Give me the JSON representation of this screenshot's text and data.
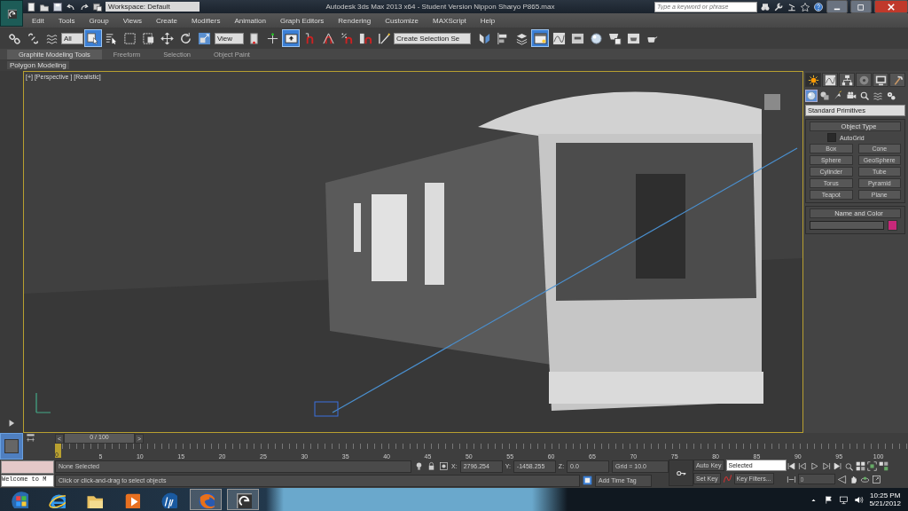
{
  "title_bar": {
    "quick_access": [
      {
        "kind": "new"
      },
      {
        "kind": "open"
      },
      {
        "kind": "save"
      },
      {
        "kind": "undo"
      },
      {
        "kind": "redo"
      },
      {
        "kind": "project"
      }
    ],
    "workspace": "Workspace: Default",
    "title": "Autodesk 3ds Max  2013 x64  - Student Version   Nippon Sharyo P865.max",
    "search": {
      "placeholder": "Type a keyword or phrase"
    },
    "tools": [
      {
        "kind": "binoculars"
      },
      {
        "kind": "wrench"
      },
      {
        "kind": "satellite"
      },
      {
        "kind": "star"
      },
      {
        "kind": "help"
      }
    ]
  },
  "menu": [
    "Edit",
    "Tools",
    "Group",
    "Views",
    "Create",
    "Modifiers",
    "Animation",
    "Graph Editors",
    "Rendering",
    "Customize",
    "MAXScript",
    "Help"
  ],
  "toolbar": [
    {
      "kind": "chain",
      "selected": false
    },
    {
      "kind": "broken-chain",
      "selected": false
    },
    {
      "kind": "wave",
      "selected": false
    },
    {
      "kind": "dropdown",
      "value": "All"
    },
    {
      "kind": "cursor-square",
      "selected": true
    },
    {
      "kind": "cursor-list",
      "selected": false
    },
    {
      "kind": "dashed-square",
      "selected": false
    },
    {
      "kind": "dashed-split",
      "selected": false
    },
    {
      "kind": "move",
      "selected": false
    },
    {
      "kind": "rotate",
      "selected": false
    },
    {
      "kind": "scale",
      "selected": false
    },
    {
      "kind": "dropdown",
      "value": "View"
    },
    {
      "kind": "pivot",
      "selected": false
    },
    {
      "kind": "crosshair",
      "selected": false
    },
    {
      "kind": "arrow-up",
      "selected": true
    },
    {
      "kind": "snap",
      "selected": false
    },
    {
      "kind": "angle-snap",
      "selected": false
    },
    {
      "kind": "percent-snap",
      "selected": false
    },
    {
      "kind": "spinner-snap",
      "selected": false
    },
    {
      "kind": "pencil",
      "selected": false
    },
    {
      "kind": "dropdown",
      "value": "Create Selection Se"
    },
    {
      "kind": "mirror",
      "selected": false
    },
    {
      "kind": "align",
      "selected": false
    },
    {
      "kind": "layers",
      "selected": false
    },
    {
      "kind": "window",
      "selected": true
    },
    {
      "kind": "curve",
      "selected": false
    },
    {
      "kind": "schematic",
      "selected": false
    },
    {
      "kind": "sphere",
      "selected": false
    },
    {
      "kind": "teapot-dialog",
      "selected": false
    },
    {
      "kind": "teapot-frame",
      "selected": false
    },
    {
      "kind": "teapot",
      "selected": false
    }
  ],
  "ribbon": {
    "tabs": [
      {
        "label": "Graphite Modeling Tools",
        "selected": true
      },
      {
        "label": "Freeform",
        "selected": false
      },
      {
        "label": "Selection",
        "selected": false
      },
      {
        "label": "Object Paint",
        "selected": false
      }
    ],
    "panel": "Polygon Modeling"
  },
  "viewport": {
    "label": "[+] [Perspective ] [Realistic]"
  },
  "command_panel": {
    "tabs": [
      {
        "kind": "sun",
        "selected": true
      },
      {
        "kind": "curve",
        "selected": false
      },
      {
        "kind": "hierarchy",
        "selected": false
      },
      {
        "kind": "disc",
        "selected": false
      },
      {
        "kind": "monitor",
        "selected": false
      },
      {
        "kind": "hammer",
        "selected": false
      }
    ],
    "categories": [
      {
        "kind": "sphere",
        "selected": true
      },
      {
        "kind": "shapes",
        "selected": false
      },
      {
        "kind": "lamp",
        "selected": false
      },
      {
        "kind": "camera",
        "selected": false
      },
      {
        "kind": "magnifier",
        "selected": false
      },
      {
        "kind": "wave",
        "selected": false
      },
      {
        "kind": "gears",
        "selected": false
      }
    ],
    "dropdown": "Standard Primitives",
    "object_type": {
      "title": "Object Type",
      "autogrid": {
        "label": "AutoGrid",
        "checked": false
      },
      "buttons": [
        "Box",
        "Cone",
        "Sphere",
        "GeoSphere",
        "Cylinder",
        "Tube",
        "Torus",
        "Pyramid",
        "Teapot",
        "Plane"
      ]
    },
    "name_and_color": {
      "title": "Name and Color",
      "color": "#c8287a"
    }
  },
  "time_slider": {
    "prev": "<",
    "frame": "0 / 100",
    "next": ">",
    "current": "0",
    "ticks": [
      "5",
      "10",
      "15",
      "20",
      "25",
      "30",
      "35",
      "40",
      "45",
      "50",
      "55",
      "60",
      "65",
      "70",
      "75",
      "80",
      "85",
      "90",
      "95",
      "100"
    ]
  },
  "status": {
    "listener": "Welcome to M",
    "selection": "None Selected",
    "prompt": "Click or click-and-drag to select objects",
    "coords": [
      {
        "axis": "X:",
        "value": "2796.254"
      },
      {
        "axis": "Y:",
        "value": "-1458.255"
      },
      {
        "axis": "Z:",
        "value": "0.0"
      }
    ],
    "grid": "Grid = 10.0",
    "time_tag": "Add Time Tag",
    "auto_key": "Auto Key",
    "set_key": "Set Key",
    "key_mode": "Selected",
    "key_filters": "Key Filters...",
    "frame": "0"
  },
  "taskbar": {
    "apps": [
      {
        "kind": "ie",
        "selected": false
      },
      {
        "kind": "folder",
        "selected": false
      },
      {
        "kind": "media",
        "selected": false
      },
      {
        "kind": "hp",
        "selected": false
      },
      {
        "kind": "firefox",
        "selected": true
      },
      {
        "kind": "max",
        "selected": true
      }
    ],
    "time": "10:25 PM",
    "date": "5/21/2012"
  }
}
